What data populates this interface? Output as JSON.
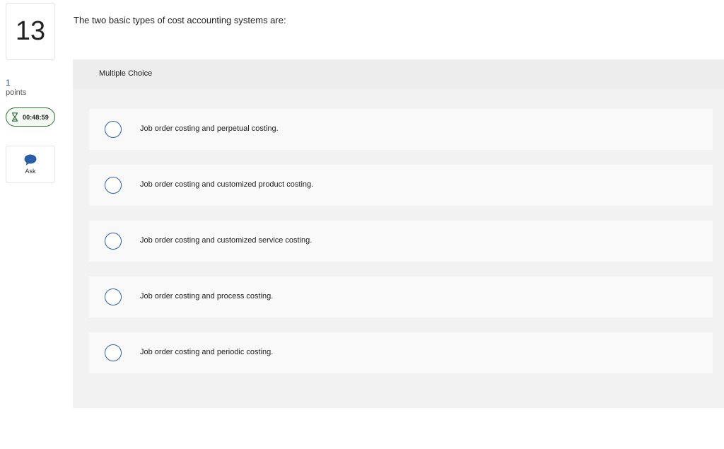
{
  "question": {
    "number": "13",
    "points_value": "1",
    "points_label": "points",
    "timer": "00:48:59",
    "ask_label": "Ask",
    "prompt": "The two basic types of cost accounting systems are:"
  },
  "answer_panel": {
    "type_label": "Multiple Choice",
    "options": [
      {
        "label": "Job order costing and perpetual costing."
      },
      {
        "label": "Job order costing and customized product costing."
      },
      {
        "label": "Job order costing and customized service costing."
      },
      {
        "label": "Job order costing and process costing."
      },
      {
        "label": "Job order costing and periodic costing."
      }
    ]
  },
  "colors": {
    "accent_blue": "#2a5ea8",
    "timer_green": "#2e6b34",
    "panel_bg": "#f2f2f2"
  },
  "icons": [
    "hourglass-icon",
    "speech-bubble-icon"
  ]
}
